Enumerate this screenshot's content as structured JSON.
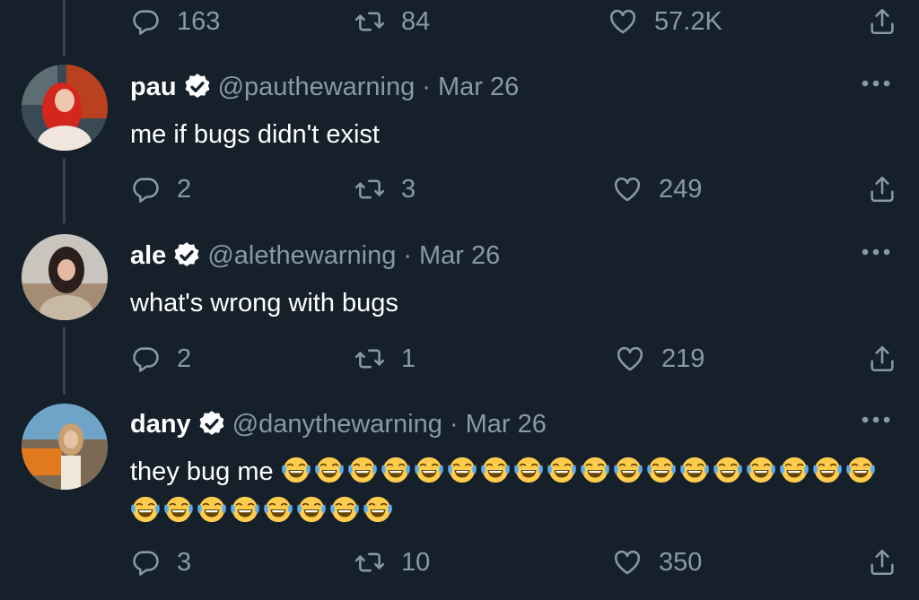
{
  "colors": {
    "background": "#15202b",
    "muted": "#8899a6",
    "text": "#ffffff",
    "thread": "#38444d"
  },
  "top_actions": {
    "replies": "163",
    "retweets": "84",
    "likes": "57.2K"
  },
  "tweets": [
    {
      "name": "pau",
      "handle": "@pauthewarning",
      "separator": "·",
      "date": "Mar 26",
      "text": "me if bugs didn't exist",
      "replies": "2",
      "retweets": "3",
      "likes": "249"
    },
    {
      "name": "ale",
      "handle": "@alethewarning",
      "separator": "·",
      "date": "Mar 26",
      "text": "what's wrong with bugs",
      "replies": "2",
      "retweets": "1",
      "likes": "219"
    },
    {
      "name": "dany",
      "handle": "@danythewarning",
      "separator": "·",
      "date": "Mar 26",
      "text": "they bug me",
      "emoji_count": 26,
      "emoji_name": "face-with-tears-of-joy",
      "replies": "3",
      "retweets": "10",
      "likes": "350"
    }
  ],
  "icons": {
    "reply": "reply-icon",
    "retweet": "retweet-icon",
    "like": "heart-icon",
    "share": "share-icon",
    "more": "more-icon",
    "verified": "verified-badge-icon"
  }
}
